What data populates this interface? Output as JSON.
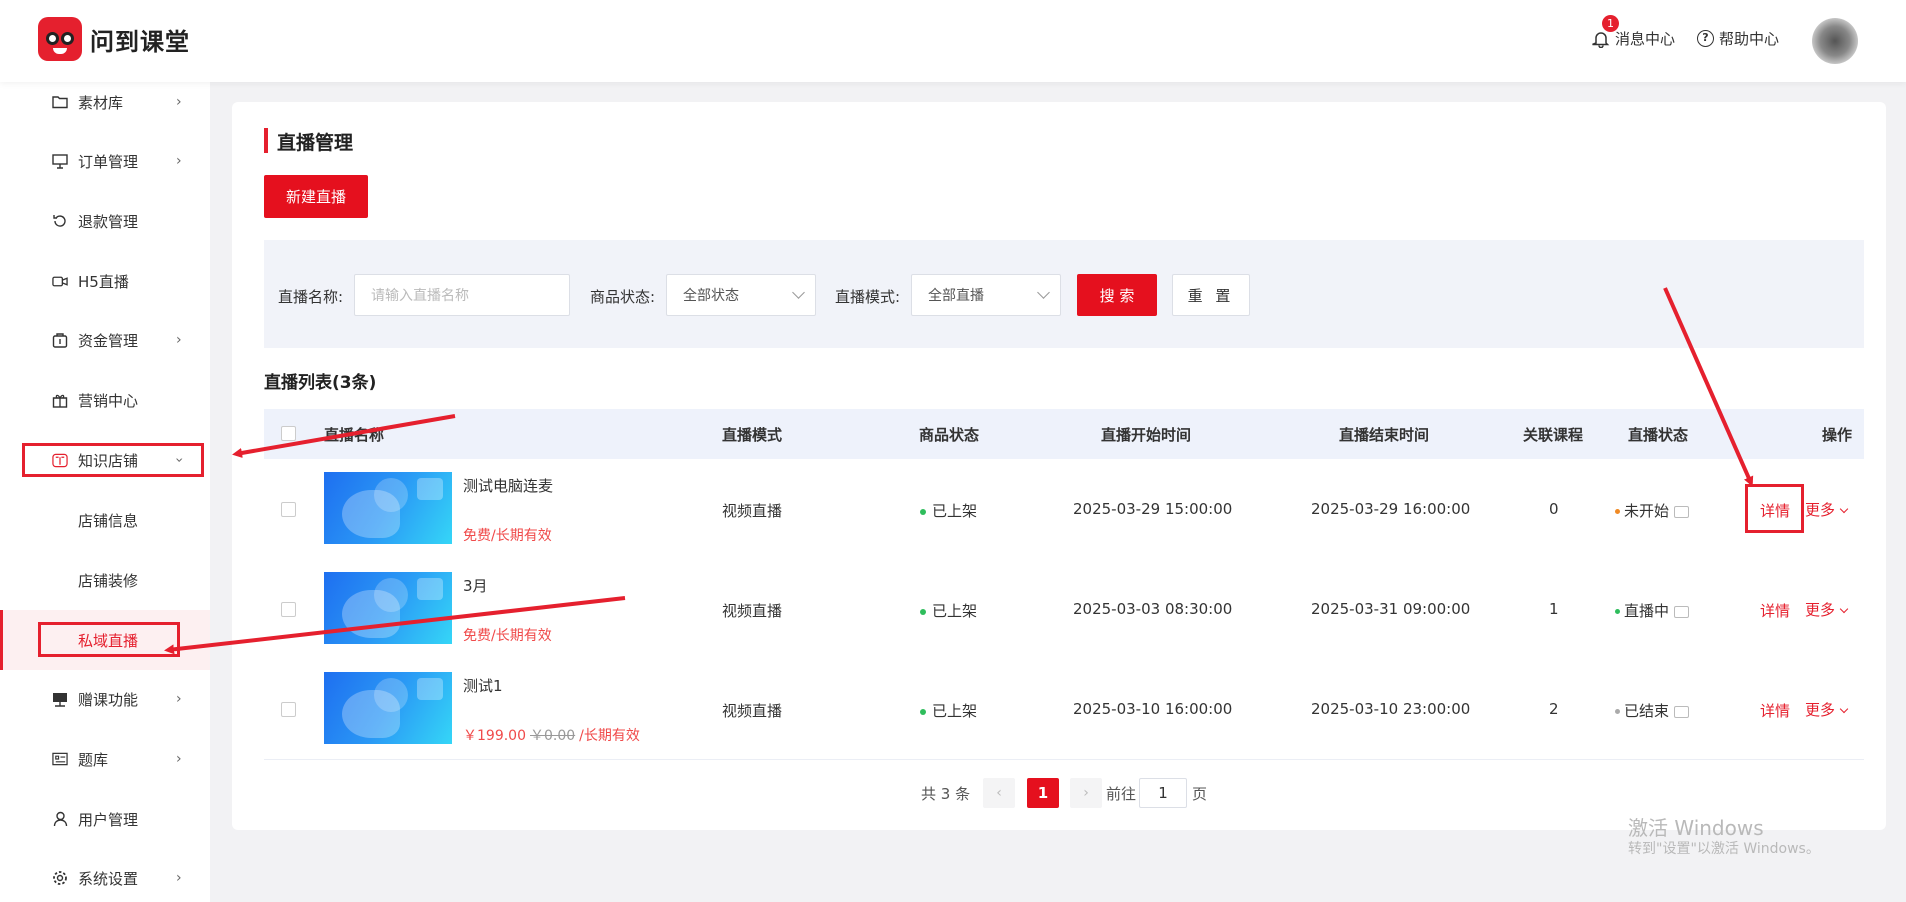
{
  "app": {
    "brand": "问到课堂"
  },
  "header": {
    "messages_label": "消息中心",
    "messages_badge": "1",
    "help_label": "帮助中心"
  },
  "sidebar": {
    "items": [
      {
        "label": "素材库",
        "icon": "folder-icon"
      },
      {
        "label": "订单管理",
        "icon": "monitor-icon"
      },
      {
        "label": "退款管理",
        "icon": "refund-icon"
      },
      {
        "label": "H5直播",
        "icon": "video-icon"
      },
      {
        "label": "资金管理",
        "icon": "wallet-icon"
      },
      {
        "label": "营销中心",
        "icon": "gift-icon"
      },
      {
        "label": "知识店铺",
        "icon": "book-icon"
      },
      {
        "label": "店铺信息"
      },
      {
        "label": "店铺装修"
      },
      {
        "label": "私域直播"
      },
      {
        "label": "赠课功能",
        "icon": "teacher-icon"
      },
      {
        "label": "题库",
        "icon": "question-bank-icon"
      },
      {
        "label": "用户管理",
        "icon": "user-icon"
      },
      {
        "label": "系统设置",
        "icon": "gear-icon"
      }
    ]
  },
  "page": {
    "title": "直播管理",
    "new_button": "新建直播",
    "filters": {
      "name_label": "直播名称:",
      "name_placeholder": "请输入直播名称",
      "status_label": "商品状态:",
      "status_value": "全部状态",
      "mode_label": "直播模式:",
      "mode_value": "全部直播",
      "search_button": "搜 索",
      "reset_button": "重 置"
    },
    "list_title": "直播列表(3条)",
    "columns": [
      "直播名称",
      "直播模式",
      "商品状态",
      "直播开始时间",
      "直播结束时间",
      "关联课程",
      "直播状态",
      "操作"
    ],
    "rows": [
      {
        "name": "测试电脑连麦",
        "price": "免费/长期有效",
        "mode": "视频直播",
        "goods_status": "已上架",
        "start": "2025-03-29 15:00:00",
        "end": "2025-03-29 16:00:00",
        "courses": "0",
        "live_status": "未开始",
        "status_color": "#f08a24",
        "detail": "详情",
        "more": "更多"
      },
      {
        "name": "3月",
        "price": "免费/长期有效",
        "mode": "视频直播",
        "goods_status": "已上架",
        "start": "2025-03-03 08:30:00",
        "end": "2025-03-31 09:00:00",
        "courses": "1",
        "live_status": "直播中",
        "status_color": "#2ebd5c",
        "detail": "详情",
        "more": "更多"
      },
      {
        "name": "测试1",
        "price_now": "￥199.00",
        "price_orig": "￥0.00",
        "price_term": "/长期有效",
        "mode": "视频直播",
        "goods_status": "已上架",
        "start": "2025-03-10 16:00:00",
        "end": "2025-03-10 23:00:00",
        "courses": "2",
        "live_status": "已结束",
        "status_color": "#aaaaaa",
        "detail": "详情",
        "more": "更多"
      }
    ],
    "pagination": {
      "total": "共 3 条",
      "current": "1",
      "goto_label": "前往",
      "goto_value": "1",
      "page_suffix": "页"
    }
  },
  "watermark": {
    "line1": "激活 Windows",
    "line2": "转到\"设置\"以激活 Windows。"
  },
  "colors": {
    "accent": "#e5202e",
    "selected_bg": "#fdf0f1",
    "header_row_bg": "#eef2fb"
  }
}
